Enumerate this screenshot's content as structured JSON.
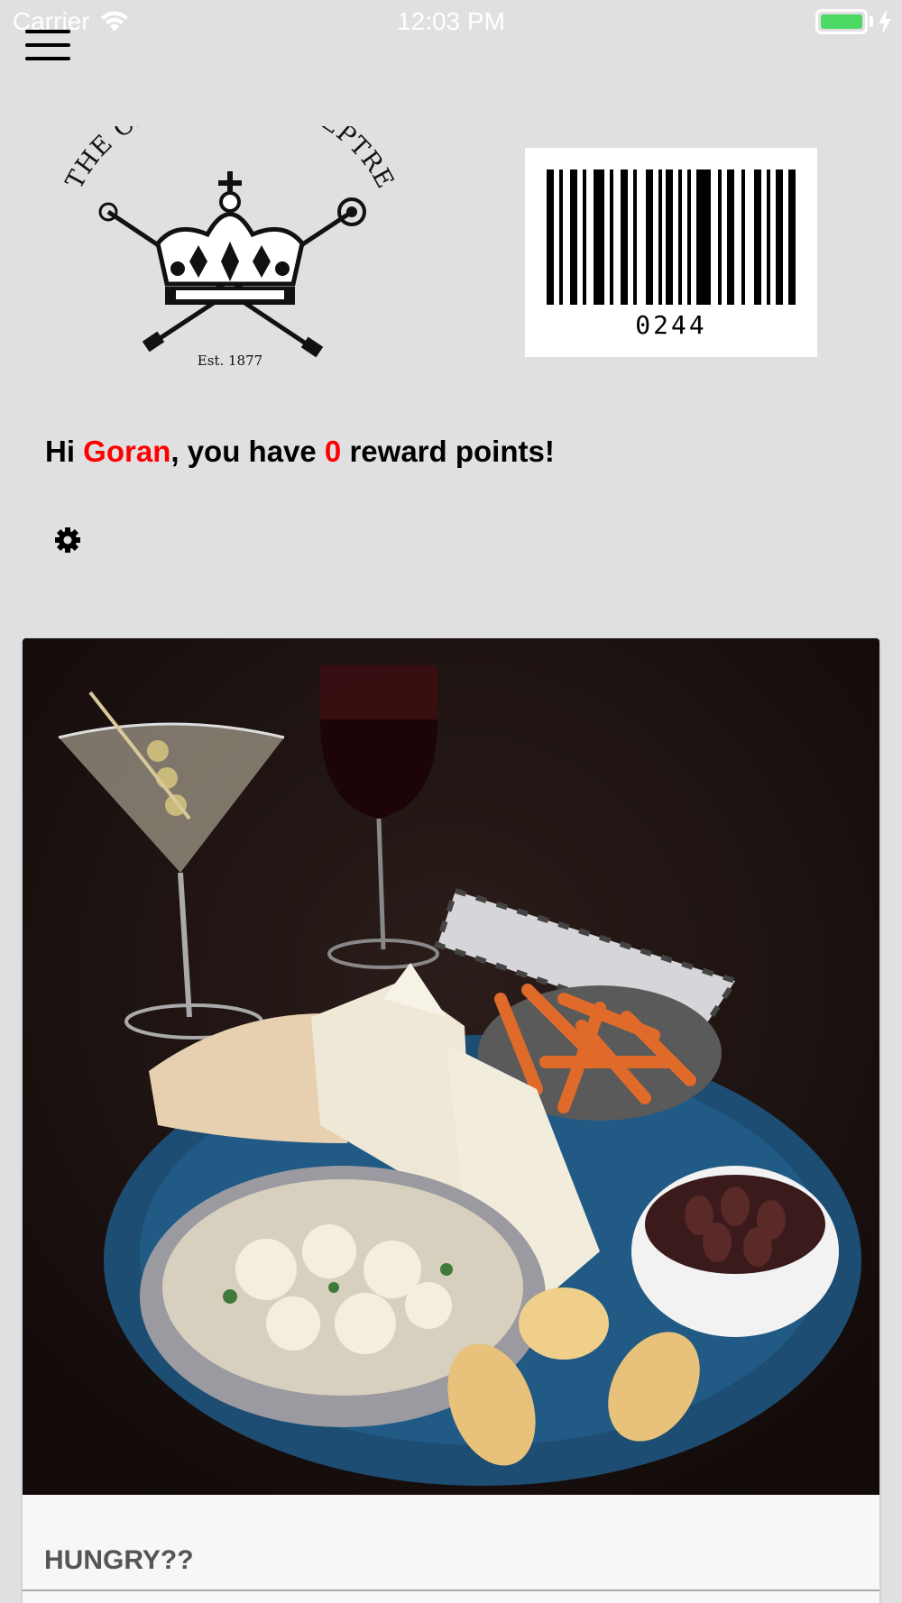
{
  "status_bar": {
    "carrier": "Carrier",
    "time": "12:03 PM",
    "battery_color": "#4cd964"
  },
  "header": {
    "menu_icon": "hamburger-menu-icon"
  },
  "logo": {
    "text_top": "THE CROWN and SCEPTRE",
    "text_bottom": "Est. 1877"
  },
  "barcode": {
    "number": "0244"
  },
  "greeting": {
    "prefix": "Hi ",
    "name": "Goran",
    "middle": ", you have ",
    "points": "0",
    "suffix": " reward points!",
    "accent_color": "#ff0000"
  },
  "settings": {
    "icon": "gear-icon"
  },
  "card": {
    "image": "food-platter-photo",
    "title": "HUNGRY??"
  }
}
